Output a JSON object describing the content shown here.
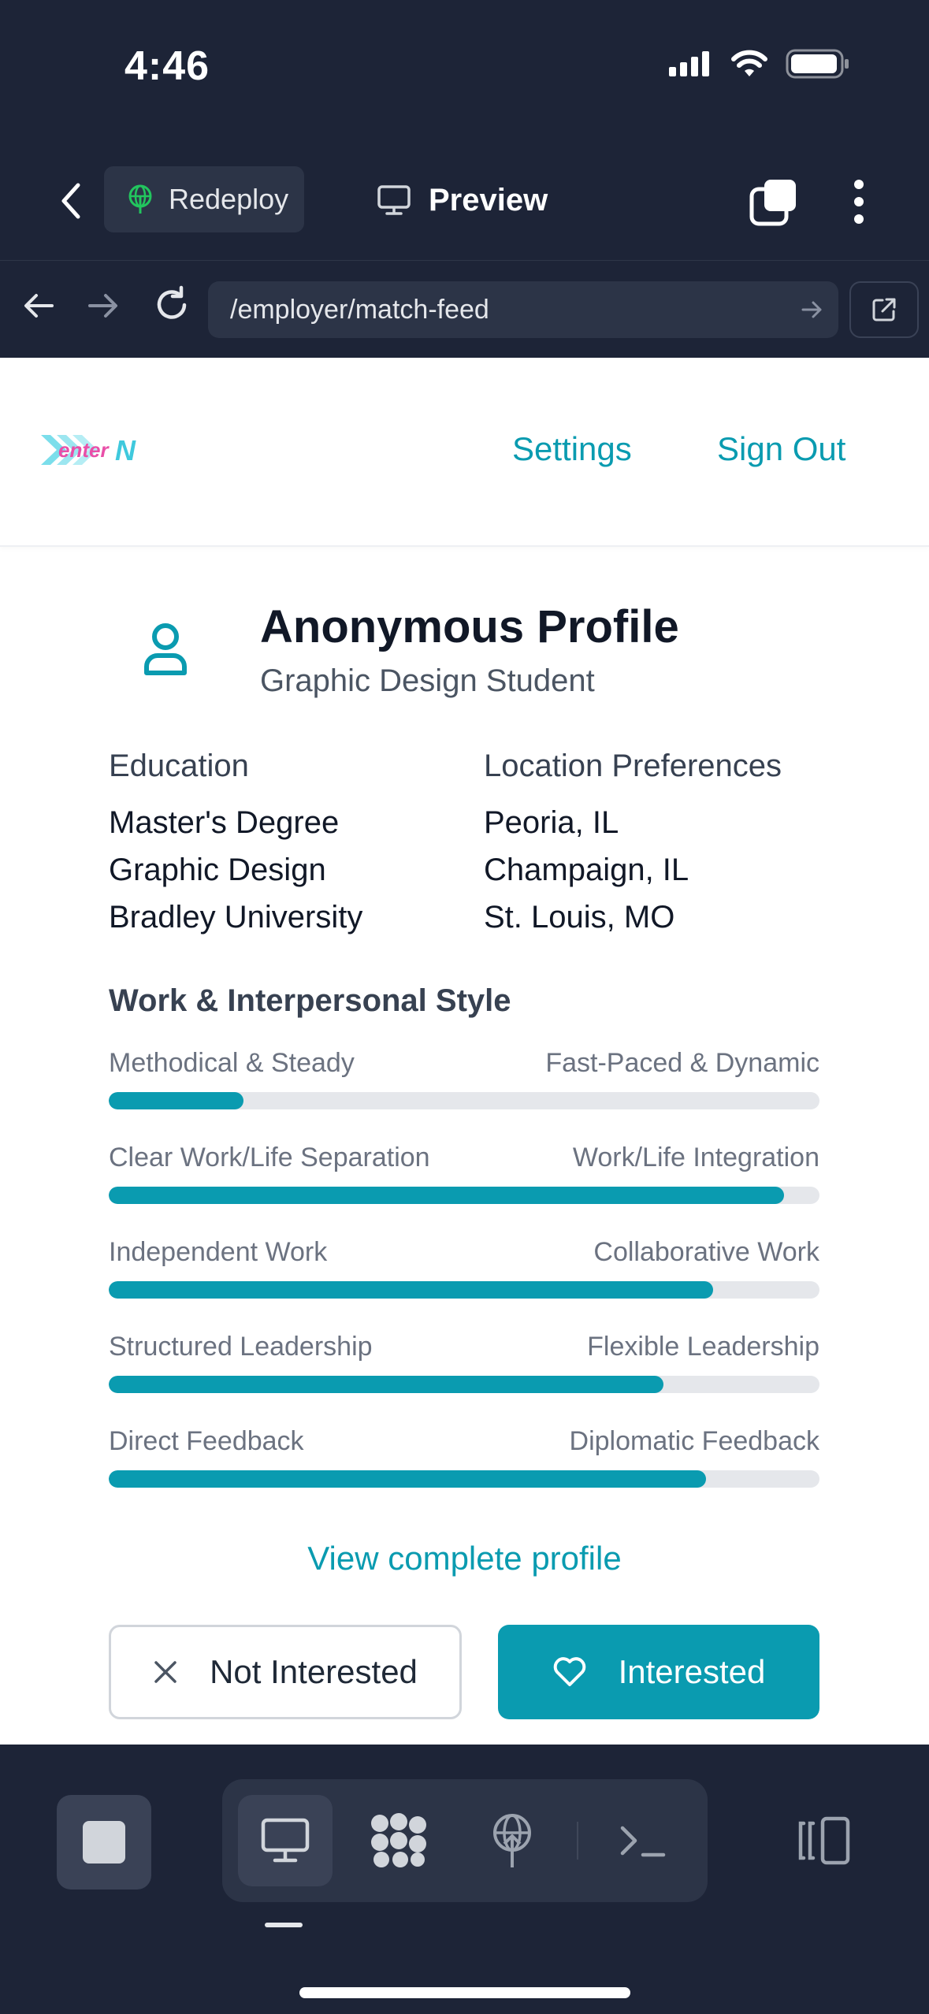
{
  "status_bar": {
    "time": "4:46"
  },
  "app_bar": {
    "redeploy_label": "Redeploy",
    "preview_label": "Preview"
  },
  "url_bar": {
    "url": "/employer/match-feed"
  },
  "site": {
    "logo_text": "enterN",
    "nav": {
      "settings": "Settings",
      "sign_out": "Sign Out"
    }
  },
  "profile": {
    "title": "Anonymous Profile",
    "subtitle": "Graphic Design Student",
    "education": {
      "heading": "Education",
      "items": [
        "Master's Degree",
        "Graphic Design",
        "Bradley University"
      ]
    },
    "location": {
      "heading": "Location Preferences",
      "items": [
        "Peoria, IL",
        "Champaign, IL",
        "St. Louis, MO"
      ]
    },
    "style": {
      "heading": "Work & Interpersonal Style",
      "sliders": [
        {
          "left": "Methodical & Steady",
          "right": "Fast-Paced & Dynamic",
          "value": 0.19
        },
        {
          "left": "Clear Work/Life Separation",
          "right": "Work/Life Integration",
          "value": 0.95
        },
        {
          "left": "Independent Work",
          "right": "Collaborative Work",
          "value": 0.85
        },
        {
          "left": "Structured Leadership",
          "right": "Flexible Leadership",
          "value": 0.78
        },
        {
          "left": "Direct Feedback",
          "right": "Diplomatic Feedback",
          "value": 0.84
        }
      ]
    },
    "view_link": "View complete profile",
    "actions": {
      "not_interested": "Not Interested",
      "interested": "Interested"
    }
  },
  "colors": {
    "accent": "#0a9bb0",
    "chrome_bg": "#1d2437",
    "logo_pink": "#e94fa8",
    "logo_cyan": "#5ad6e6"
  }
}
